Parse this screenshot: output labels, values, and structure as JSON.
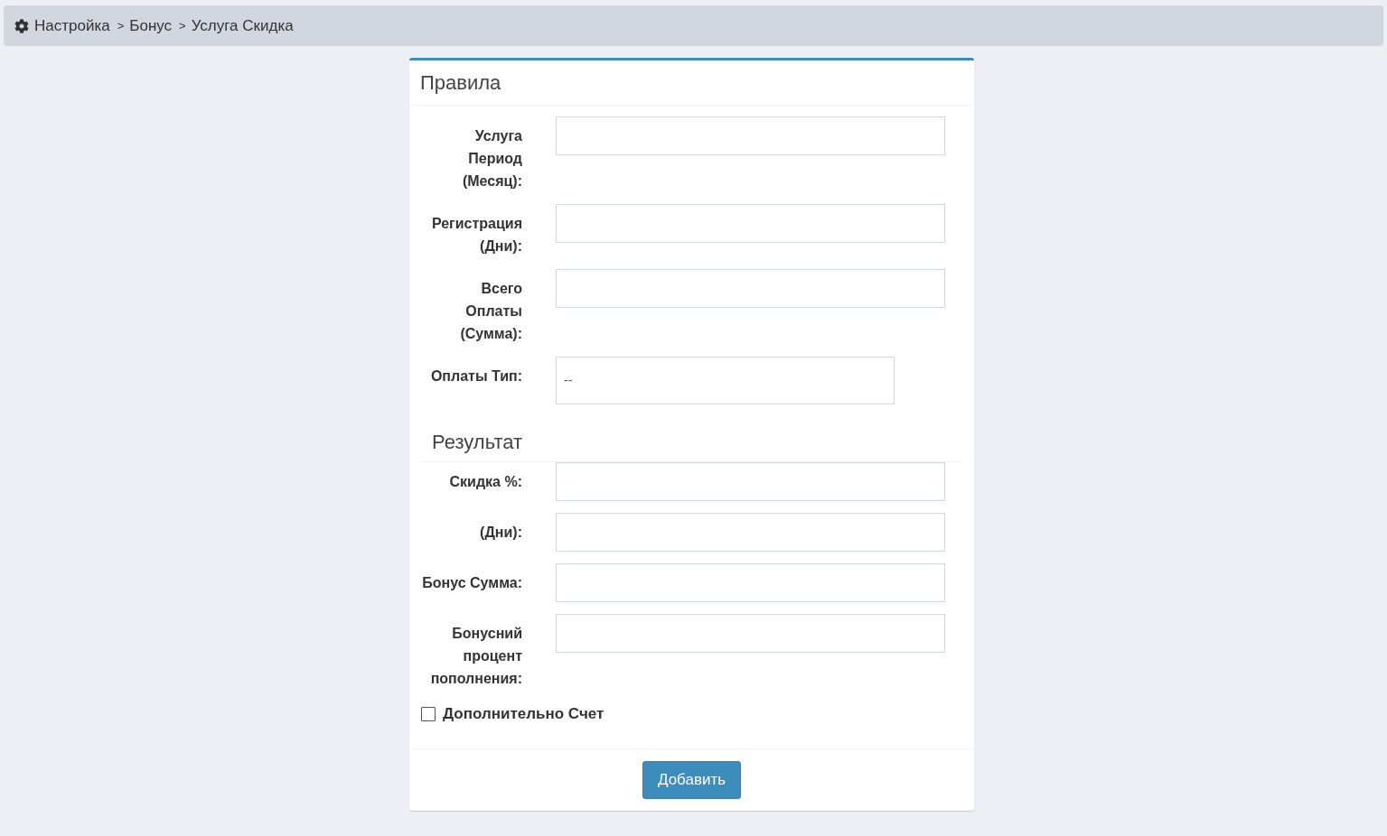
{
  "breadcrumb": {
    "items": [
      "Настройка",
      "Бонус",
      "Услуга Скидка"
    ],
    "separators": [
      ">",
      ">"
    ]
  },
  "card": {
    "title": "Правила",
    "rules": [
      {
        "kind": "input",
        "label": "Услуга Период (Месяц):"
      },
      {
        "kind": "input",
        "label": "Регистрация (Дни):"
      },
      {
        "kind": "input",
        "label": "Всего Оплаты (Сумма):"
      },
      {
        "kind": "select",
        "label": "Оплаты Тип:",
        "value": "--"
      }
    ],
    "result_title": "Результат",
    "results": [
      {
        "kind": "input",
        "label": "Скидка %:"
      },
      {
        "kind": "input",
        "label": "(Дни):"
      },
      {
        "kind": "input",
        "label": "Бонус Сумма:"
      },
      {
        "kind": "input",
        "label": "Бонусний процент пополнения:"
      }
    ],
    "checkbox": {
      "label": "Дополнительно Счет",
      "checked": false
    },
    "submit": "Добавить"
  }
}
